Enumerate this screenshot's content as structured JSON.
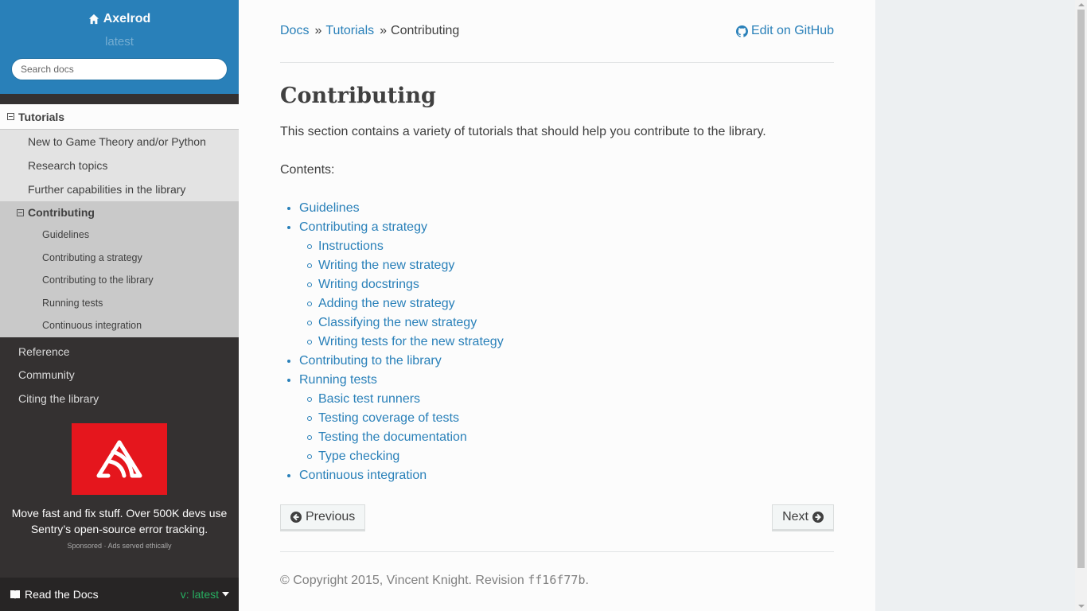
{
  "project": {
    "name": "Axelrod",
    "version": "latest",
    "icon": "home-icon"
  },
  "search": {
    "placeholder": "Search docs"
  },
  "nav": {
    "tutorials_label": "Tutorials",
    "tutorials_items": [
      "New to Game Theory and/or Python",
      "Research topics",
      "Further capabilities in the library"
    ],
    "contributing_label": "Contributing",
    "contributing_items": [
      "Guidelines",
      "Contributing a strategy",
      "Contributing to the library",
      "Running tests",
      "Continuous integration"
    ],
    "other_items": [
      "Reference",
      "Community",
      "Citing the library"
    ]
  },
  "ad": {
    "brand_icon": "sentry-logo",
    "brand_color": "#e5161d",
    "text": "Move fast and fix stuff. Over 500K devs use Sentry’s open-source error tracking.",
    "small": "Sponsored · Ads served ethically"
  },
  "rtd": {
    "label": "Read the Docs",
    "version": "v: latest"
  },
  "breadcrumb": {
    "docs": "Docs",
    "sep": "»",
    "tutorials": "Tutorials",
    "current": "Contributing",
    "edit": "Edit on GitHub"
  },
  "page": {
    "title": "Contributing",
    "description": "This section contains a variety of tutorials that should help you contribute to the library.",
    "contents_label": "Contents:"
  },
  "toc": {
    "guidelines": "Guidelines",
    "strategy": "Contributing a strategy",
    "strategy_items": [
      "Instructions",
      "Writing the new strategy",
      "Writing docstrings",
      "Adding the new strategy",
      "Classifying the new strategy",
      "Writing tests for the new strategy"
    ],
    "library": "Contributing to the library",
    "tests": "Running tests",
    "tests_items": [
      "Basic test runners",
      "Testing coverage of tests",
      "Testing the documentation",
      "Type checking"
    ],
    "ci": "Continuous integration"
  },
  "pager": {
    "previous": "Previous",
    "next": "Next"
  },
  "footer": {
    "prefix": "© Copyright 2015, Vincent Knight. Revision ",
    "revision": "ff16f77b",
    "suffix": "."
  },
  "colors": {
    "sidebar_top": "#2980b9",
    "sidebar_bg": "#343131",
    "link": "#2980b9",
    "rtd_version": "#27ae60"
  }
}
